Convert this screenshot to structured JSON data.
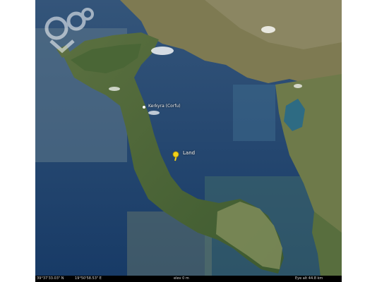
{
  "map": {
    "places": {
      "kerkyra": "Kerkyra (Corfu)",
      "pin": "Land"
    },
    "status": {
      "latitude": "39°37'33.03\" N",
      "longitude": "19°50'58.53\" E",
      "elevation": "elev  0 m",
      "eye_alt": "Eye alt   44.8 km"
    },
    "colors": {
      "sea_deep": "#1d3f6b",
      "sea_shallow": "#3b5f7a",
      "land_green": "#4c6a37",
      "land_tan": "#8e8a63",
      "pin": "#f2d11b"
    },
    "icons": {
      "pin": "yellow-pushpin-icon",
      "watermark": "watermark-logo"
    }
  }
}
